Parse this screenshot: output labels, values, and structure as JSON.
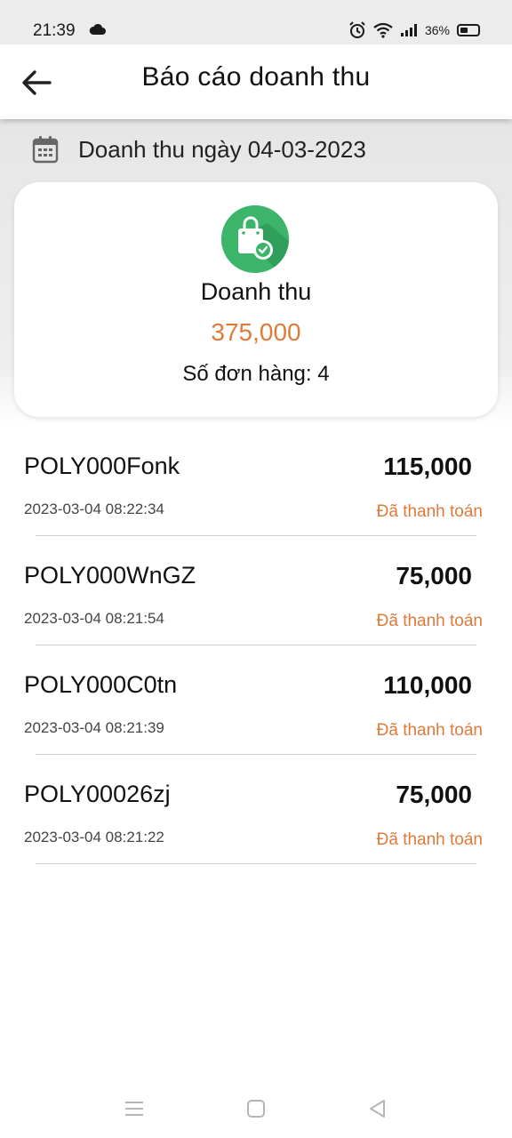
{
  "status_bar": {
    "time": "21:39",
    "battery_text": "36%",
    "icons": [
      "cloud-icon",
      "alarm-icon",
      "wifi-icon",
      "signal-icon",
      "battery-icon"
    ]
  },
  "app_bar": {
    "title": "Báo cáo doanh thu",
    "back_icon": "arrow-left-icon"
  },
  "date_row": {
    "icon": "calendar-icon",
    "text": "Doanh thu ngày 04-03-2023"
  },
  "summary": {
    "icon": "shopping-bag-check-icon",
    "label": "Doanh thu",
    "amount": "375,000",
    "orders_text": "Số đơn hàng: 4"
  },
  "orders": [
    {
      "code": "POLY000Fonk",
      "total": "115,000",
      "time": "2023-03-04 08:22:34",
      "status": "Đã thanh toán"
    },
    {
      "code": "POLY000WnGZ",
      "total": "75,000",
      "time": "2023-03-04 08:21:54",
      "status": "Đã thanh toán"
    },
    {
      "code": "POLY000C0tn",
      "total": "110,000",
      "time": "2023-03-04 08:21:39",
      "status": "Đã thanh toán"
    },
    {
      "code": "POLY00026zj",
      "total": "75,000",
      "time": "2023-03-04 08:21:22",
      "status": "Đã thanh toán"
    }
  ],
  "colors": {
    "accent_orange": "#e07a3a",
    "icon_green": "#3cb56b",
    "header_gray": "#ececec"
  },
  "nav_bar": {
    "icons": [
      "menu-icon",
      "home-square-icon",
      "back-triangle-icon"
    ]
  }
}
